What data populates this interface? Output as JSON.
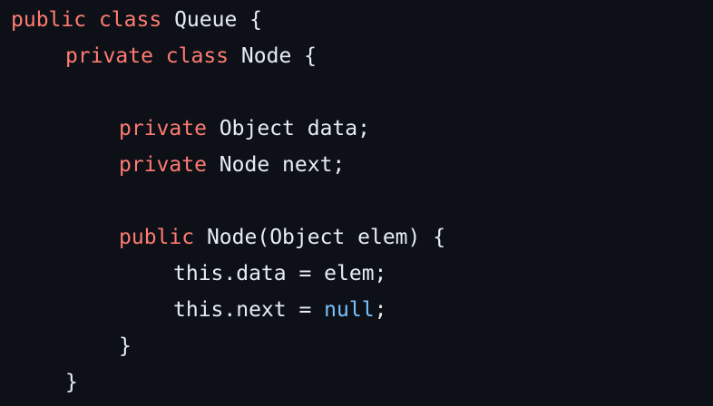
{
  "colors": {
    "background": "#0d1117",
    "text": "#e6edf3",
    "keyword": "#ff7b72",
    "literal": "#79c0ff"
  },
  "code": {
    "line1": {
      "kw1": "public",
      "kw2": "class",
      "rest": "Queue {"
    },
    "line2": {
      "kw1": "private",
      "kw2": "class",
      "rest": "Node {"
    },
    "line4": {
      "kw": "private",
      "rest": "Object data;"
    },
    "line5": {
      "kw": "private",
      "rest": "Node next;"
    },
    "line7": {
      "kw": "public",
      "rest": "Node(Object elem) {"
    },
    "line8": {
      "text": "this.data = elem;"
    },
    "line9": {
      "before": "this.next = ",
      "literal": "null",
      "after": ";"
    },
    "line10": {
      "text": "}"
    },
    "line11": {
      "text": "}"
    }
  }
}
